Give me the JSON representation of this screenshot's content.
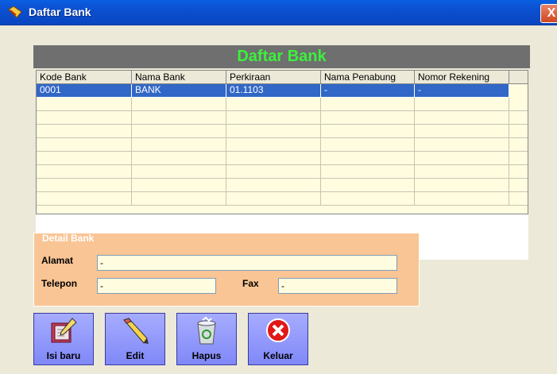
{
  "window": {
    "title": "Daftar Bank",
    "close_glyph": "X"
  },
  "grid": {
    "header": "Daftar Bank",
    "columns": [
      "Kode Bank",
      "Nama Bank",
      "Perkiraan",
      "Nama Penabung",
      "Nomor Rekening"
    ],
    "rows": [
      [
        "0001",
        "BANK",
        "01.1103",
        "-",
        "-"
      ]
    ]
  },
  "detail": {
    "legend": "Detail Bank",
    "alamat_label": "Alamat",
    "alamat_value": "-",
    "telepon_label": "Telepon",
    "telepon_value": "-",
    "fax_label": "Fax",
    "fax_value": "-"
  },
  "buttons": {
    "isi_baru": "Isi baru",
    "edit": "Edit",
    "hapus": "Hapus",
    "keluar": "Keluar"
  },
  "icons": {
    "app": "folder-icon",
    "isi_baru": "notebook-pen-icon",
    "edit": "pencil-icon",
    "hapus": "recycle-bin-icon",
    "keluar": "close-circle-icon"
  },
  "colors": {
    "selected_row": "#3167c6",
    "header_text": "#3cf03c",
    "detail_bg": "#f9c594"
  }
}
